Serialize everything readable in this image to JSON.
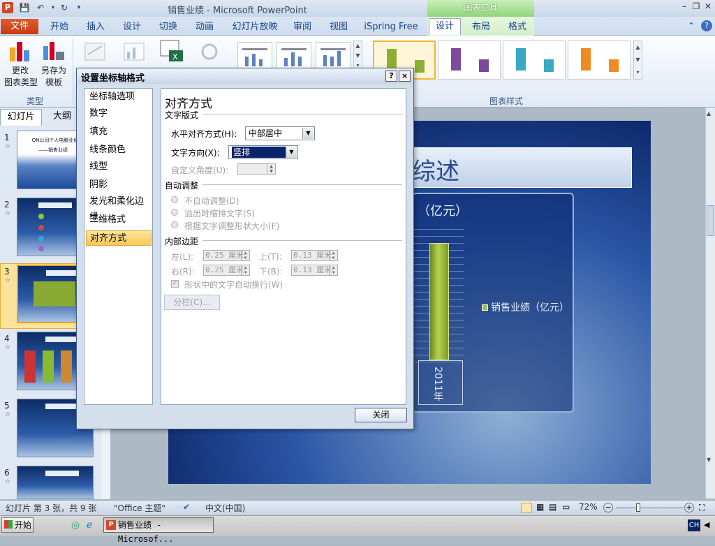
{
  "window": {
    "title": "销售业绩 - Microsoft PowerPoint",
    "context_group": "图表工具",
    "app_icon": "P"
  },
  "tabs": [
    "文件",
    "开始",
    "插入",
    "设计",
    "切换",
    "动画",
    "幻灯片放映",
    "审阅",
    "视图",
    "iSpring Free",
    "设计",
    "布局",
    "格式"
  ],
  "ribbon": {
    "change_type_line1": "更改",
    "change_type_line2": "图表类型",
    "save_as_line1": "另存为",
    "save_as_line2": "模板",
    "group_type": "类型",
    "group_chart_styles": "图表样式",
    "style_colors": [
      "#8cae32",
      "#7b4a9e",
      "#3aa9c4",
      "#f08a22"
    ]
  },
  "left_panel": {
    "tab_slides": "幻灯片",
    "tab_outline": "大纲",
    "slide_numbers": [
      "1",
      "2",
      "3",
      "4",
      "5",
      "6"
    ],
    "slide1_title": "QN公司个人电脑业绩",
    "slide1_sub": "——销售业绩"
  },
  "slide": {
    "title": "综述",
    "chart_title": "（亿元）",
    "legend": "销售业绩（亿元）"
  },
  "chart_data": {
    "type": "bar",
    "categories": [
      "2011年"
    ],
    "series": [
      {
        "name": "销售业绩（亿元）",
        "values": [
          7.5
        ]
      }
    ],
    "title": "（亿元）"
  },
  "dialog": {
    "title": "设置坐标轴格式",
    "help": "?",
    "close_x": "×",
    "nav": [
      "坐标轴选项",
      "数字",
      "填充",
      "线条颜色",
      "线型",
      "阴影",
      "发光和柔化边缘",
      "三维格式",
      "对齐方式"
    ],
    "heading": "对齐方式",
    "section_text_layout": "文字版式",
    "h_align_label": "水平对齐方式(H):",
    "h_align_value": "中部居中",
    "text_dir_label": "文字方向(X):",
    "text_dir_value": "竖排",
    "custom_angle_label": "自定义角度(U):",
    "section_autofit": "自动调整",
    "autofit_opts": [
      "不自动调整(D)",
      "溢出时缩排文字(S)",
      "根据文字调整形状大小(F)"
    ],
    "section_margins": "内部边距",
    "left_label": "左(L):",
    "top_label": "上(T):",
    "right_label": "右(R):",
    "bottom_label": "下(B):",
    "left_value": "0.25 厘米",
    "top_value": "0.13 厘米",
    "right_value": "0.25 厘米",
    "bottom_value": "0.13 厘米",
    "wrap_label": "形状中的文字自动换行(W)",
    "columns_btn": "分栏(C)...",
    "close_btn": "关闭"
  },
  "status": {
    "slide_info": "幻灯片 第 3 张，共 9 张",
    "theme": "\"Office 主题\"",
    "language": "中文(中国)",
    "zoom": "72%"
  },
  "taskbar": {
    "start": "开始",
    "task": "销售业绩 - Microsof...",
    "ime": "CH"
  }
}
